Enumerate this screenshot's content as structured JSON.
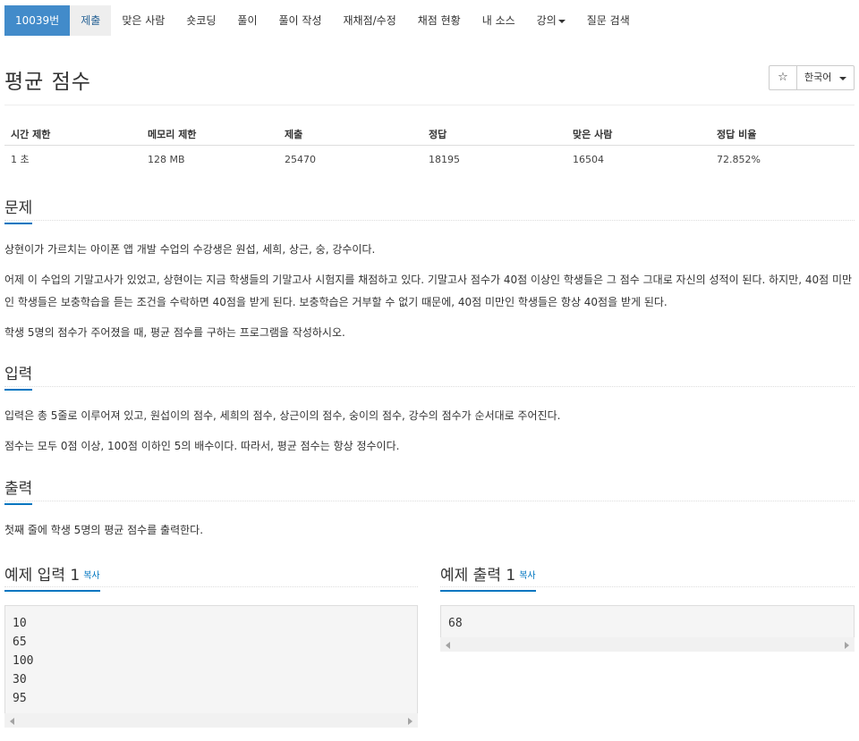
{
  "nav": {
    "problem_id": "10039번",
    "tabs": [
      "제출",
      "맞은 사람",
      "숏코딩",
      "풀이",
      "풀이 작성",
      "재채점/수정",
      "채점 현황",
      "내 소스",
      "강의",
      "질문 검색"
    ]
  },
  "title": "평균 점수",
  "star_glyph": "☆",
  "language": "한국어",
  "stats": {
    "headers": [
      "시간 제한",
      "메모리 제한",
      "제출",
      "정답",
      "맞은 사람",
      "정답 비율"
    ],
    "values": [
      "1 초",
      "128 MB",
      "25470",
      "18195",
      "16504",
      "72.852%"
    ]
  },
  "sections": {
    "problem": {
      "title": "문제",
      "paragraphs": [
        "상현이가 가르치는 아이폰 앱 개발 수업의 수강생은 원섭, 세희, 상근, 숭, 강수이다.",
        "어제 이 수업의 기말고사가 있었고, 상현이는 지금 학생들의 기말고사 시험지를 채점하고 있다. 기말고사 점수가 40점 이상인 학생들은 그 점수 그대로 자신의 성적이 된다. 하지만, 40점 미만인 학생들은 보충학습을 듣는 조건을 수락하면 40점을 받게 된다. 보충학습은 거부할 수 없기 때문에, 40점 미만인 학생들은 항상 40점을 받게 된다.",
        "학생 5명의 점수가 주어졌을 때, 평균 점수를 구하는 프로그램을 작성하시오."
      ]
    },
    "input": {
      "title": "입력",
      "paragraphs": [
        "입력은 총 5줄로 이루어져 있고, 원섭이의 점수, 세희의 점수, 상근이의 점수, 숭이의 점수, 강수의 점수가 순서대로 주어진다.",
        "점수는 모두 0점 이상, 100점 이하인 5의 배수이다. 따라서, 평균 점수는 항상 정수이다."
      ]
    },
    "output": {
      "title": "출력",
      "paragraphs": [
        "첫째 줄에 학생 5명의 평균 점수를 출력한다."
      ]
    }
  },
  "sample_input": {
    "title": "예제 입력 1",
    "copy_label": "복사",
    "content": "10\n65\n100\n30\n95"
  },
  "sample_output": {
    "title": "예제 출력 1",
    "copy_label": "복사",
    "content": "68"
  }
}
